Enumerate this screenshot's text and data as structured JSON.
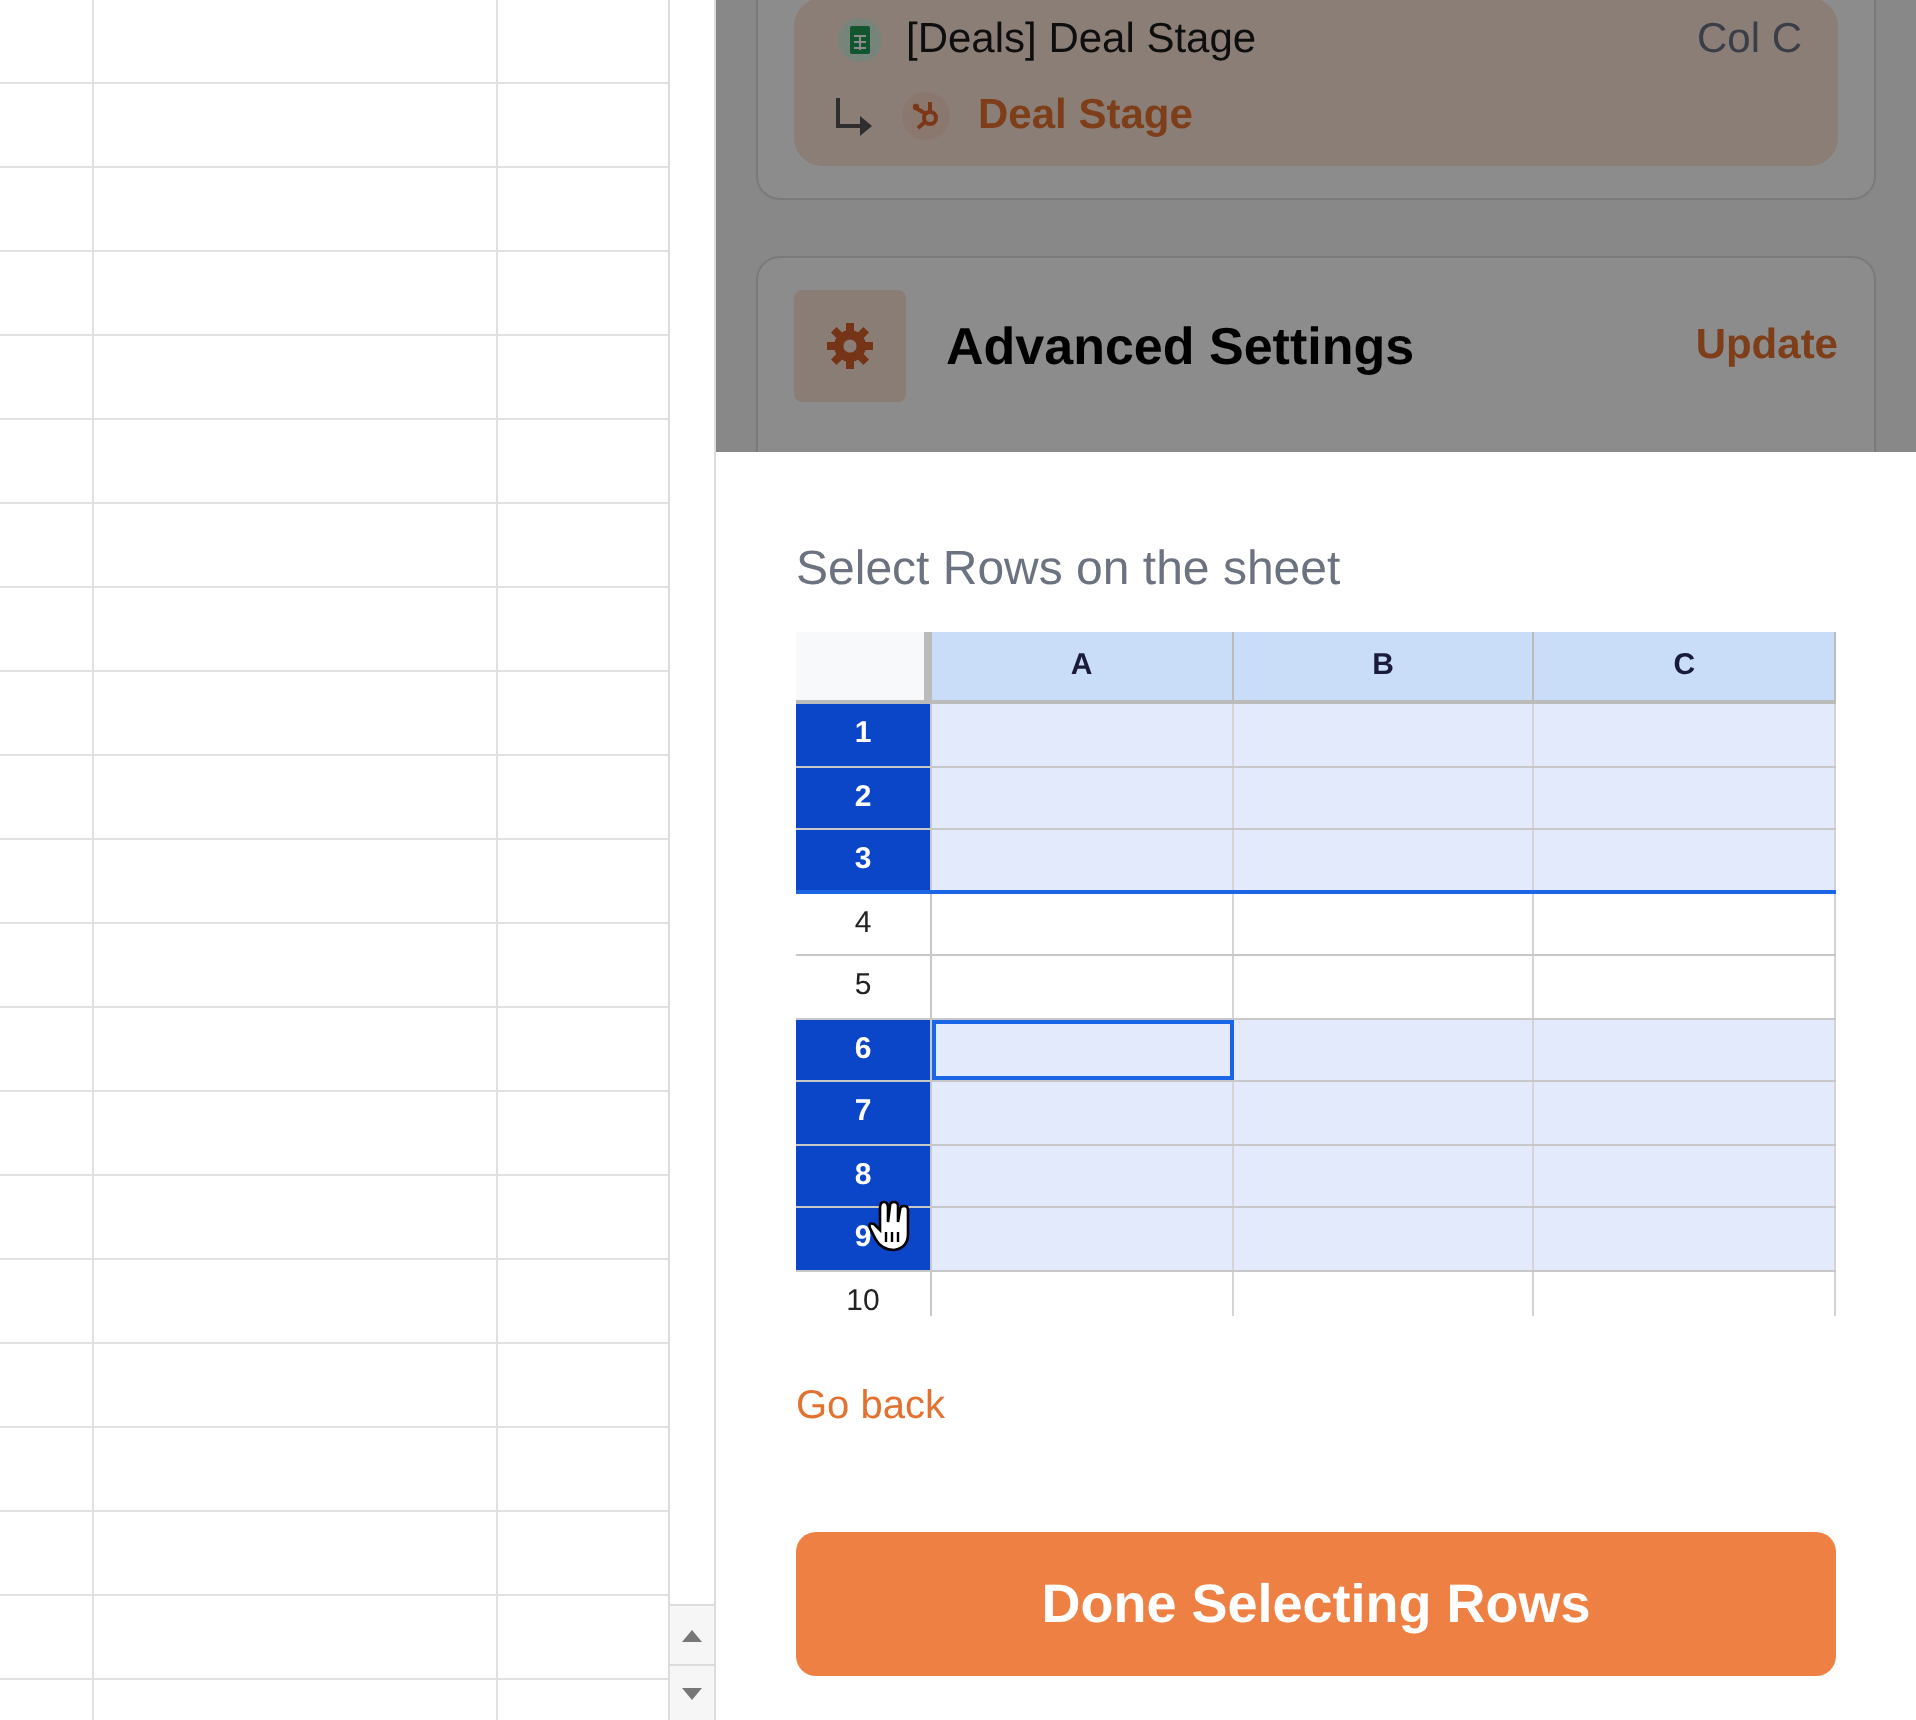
{
  "mapping": {
    "sheet_column": "[Deals] Deal Stage",
    "column_ref": "Col C",
    "target_field": "Deal Stage"
  },
  "advanced_settings": {
    "title": "Advanced Settings",
    "action": "Update"
  },
  "select_rows": {
    "prompt": "Select Rows on the sheet",
    "sheet_preview": {
      "columns": [
        "A",
        "B",
        "C"
      ],
      "rows": [
        {
          "label": "1",
          "selected": true,
          "active": false
        },
        {
          "label": "2",
          "selected": true,
          "active": false
        },
        {
          "label": "3",
          "selected": true,
          "active": false
        },
        {
          "label": "4",
          "selected": false,
          "active": false
        },
        {
          "label": "5",
          "selected": false,
          "active": false
        },
        {
          "label": "6",
          "selected": true,
          "active": true
        },
        {
          "label": "7",
          "selected": true,
          "active": false
        },
        {
          "label": "8",
          "selected": true,
          "active": false
        },
        {
          "label": "9",
          "selected": true,
          "active": false
        },
        {
          "label": "10",
          "selected": false,
          "active": false
        }
      ]
    },
    "go_back": "Go back",
    "done_button": "Done Selecting Rows"
  }
}
